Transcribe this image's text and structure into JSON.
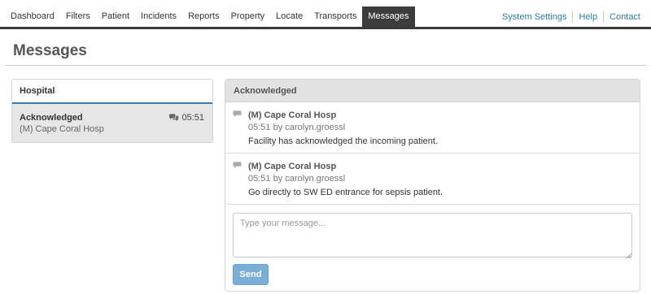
{
  "nav": {
    "items": [
      {
        "label": "Dashboard",
        "active": false
      },
      {
        "label": "Filters",
        "active": false
      },
      {
        "label": "Patient",
        "active": false
      },
      {
        "label": "Incidents",
        "active": false
      },
      {
        "label": "Reports",
        "active": false
      },
      {
        "label": "Property",
        "active": false
      },
      {
        "label": "Locate",
        "active": false
      },
      {
        "label": "Transports",
        "active": false
      },
      {
        "label": "Messages",
        "active": true
      }
    ],
    "right_links": [
      "System Settings",
      "Help",
      "Contact"
    ]
  },
  "page": {
    "title": "Messages"
  },
  "hospital_panel": {
    "header": "Hospital",
    "items": [
      {
        "status": "Acknowledged",
        "name": "(M) Cape Coral Hosp",
        "time": "05:51",
        "icon": "comments-icon"
      }
    ]
  },
  "conversation": {
    "header": "Acknowledged",
    "messages": [
      {
        "sender": "(M) Cape Coral Hosp",
        "meta": "05:51 by carolyn.groessl",
        "body": "Facility has acknowledged the incoming patient.",
        "icon": "comment-icon"
      },
      {
        "sender": "(M) Cape Coral Hosp",
        "meta": "05:51 by carolyn.groessl",
        "body": "Go directly to SW ED entrance for sepsis patient.",
        "icon": "comment-icon"
      }
    ],
    "compose": {
      "placeholder": "Type your message...",
      "value": ""
    },
    "send_label": "Send"
  },
  "colors": {
    "nav_active_bg": "#3d3d3d",
    "link": "#2a7bb5",
    "panel_accent": "#3b7cb0",
    "send_button": "#7aaed6",
    "selected_item_bg": "#e6e6e6"
  }
}
